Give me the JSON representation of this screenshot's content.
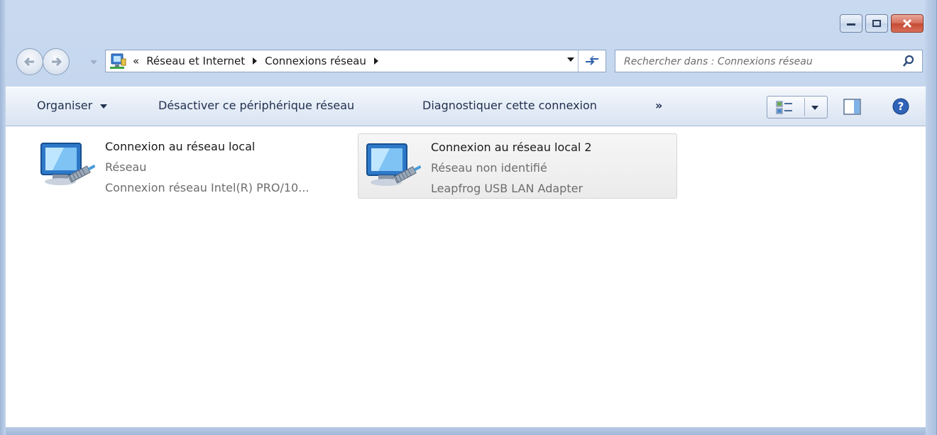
{
  "window": {
    "minimize_icon": "minimize-icon",
    "maximize_icon": "maximize-icon",
    "close_icon": "close-icon",
    "close_color": "#c8462f"
  },
  "navigation": {
    "back_icon": "back-arrow-icon",
    "forward_icon": "forward-arrow-icon"
  },
  "address_bar": {
    "overflow": "«",
    "crumbs": [
      {
        "label": "Réseau et Internet"
      },
      {
        "label": "Connexions réseau"
      }
    ],
    "refresh_icon": "refresh-icon"
  },
  "search": {
    "placeholder": "Rechercher dans : Connexions réseau"
  },
  "toolbar": {
    "organize_label": "Organiser",
    "disable_label": "Désactiver ce périphérique réseau",
    "diagnose_label": "Diagnostiquer cette connexion",
    "more_label": "»",
    "view_icon": "view-details-icon",
    "preview_pane_icon": "preview-pane-icon",
    "help_icon": "help-icon"
  },
  "connections": [
    {
      "name": "Connexion au réseau local",
      "network": "Réseau",
      "adapter": "Connexion réseau Intel(R) PRO/10...",
      "selected": false
    },
    {
      "name": "Connexion au réseau local 2",
      "network": "Réseau non identifié",
      "adapter": "Leapfrog USB LAN Adapter",
      "selected": true
    }
  ]
}
